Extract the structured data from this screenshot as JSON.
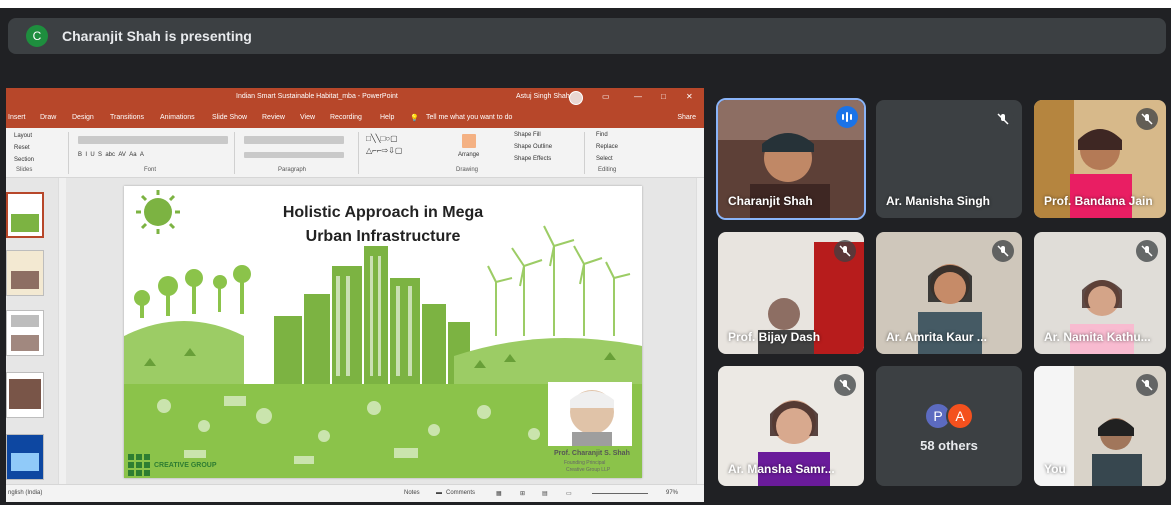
{
  "banner": {
    "avatar_letter": "C",
    "text": "Charanjit Shah is presenting"
  },
  "powerpoint": {
    "window_title": "Indian Smart Sustainable Habitat_mba - PowerPoint",
    "user_name": "Astuj Singh Shah",
    "tabs": [
      "Insert",
      "Draw",
      "Design",
      "Transitions",
      "Animations",
      "Slide Show",
      "Review",
      "View",
      "Recording",
      "Help"
    ],
    "tell_me": "Tell me what you want to do",
    "share": "Share",
    "ribbon": {
      "slides_group": {
        "layout": "Layout",
        "reset": "Reset",
        "section": "Section",
        "label": "Slides"
      },
      "font_label": "Font",
      "paragraph_label": "Paragraph",
      "drawing": {
        "arrange": "Arrange",
        "quick_styles": "Quick Styles",
        "shape_fill": "Shape Fill",
        "shape_outline": "Shape Outline",
        "shape_effects": "Shape Effects",
        "label": "Drawing"
      },
      "editing": {
        "find": "Find",
        "replace": "Replace",
        "select": "Select",
        "label": "Editing"
      }
    },
    "slide": {
      "title_line1": "Holistic Approach in Mega",
      "title_line2": "Urban Infrastructure",
      "presenter": "Prof. Charanjit S. Shah",
      "role1": "Founding Principal",
      "role2": "Creative Group LLP",
      "logo_text": "CREATIVE GROUP"
    },
    "status": {
      "language": "nglish (India)",
      "notes": "Notes",
      "comments": "Comments",
      "zoom": "97%"
    },
    "colors": {
      "accent": "#b7472a",
      "slide_green": "#7cb342"
    }
  },
  "participants": [
    {
      "name": "Charanjit Shah",
      "state": "speaking"
    },
    {
      "name": "Ar. Manisha Singh",
      "state": "muted"
    },
    {
      "name": "Prof. Bandana Jain",
      "state": "muted"
    },
    {
      "name": "Prof. Bijay Dash",
      "state": "muted"
    },
    {
      "name": "Ar. Amrita Kaur ...",
      "state": "muted"
    },
    {
      "name": "Ar. Namita Kathu...",
      "state": "muted"
    },
    {
      "name": "Ar. Mansha Samr...",
      "state": "muted"
    },
    {
      "name": "58 others",
      "avatars": [
        "P",
        "A"
      ],
      "avatar_colors": [
        "#5c6bc0",
        "#f4511e"
      ]
    },
    {
      "name": "You",
      "state": "muted"
    }
  ]
}
